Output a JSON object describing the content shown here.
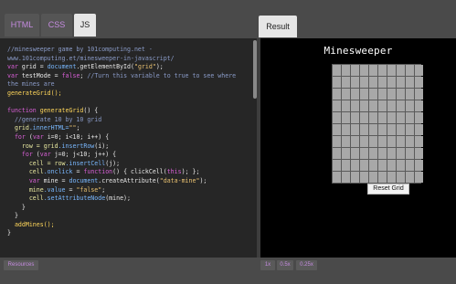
{
  "tabs": {
    "html": "HTML",
    "css": "CSS",
    "js": "JS",
    "result": "Result"
  },
  "result": {
    "title": "Minesweeper",
    "grid_rows": 10,
    "grid_cols": 10,
    "reset_label": "Reset Grid"
  },
  "footer": {
    "resources_label": "Resources",
    "zoom_options": [
      "1x",
      "0.5x",
      "0.25x"
    ]
  },
  "code": {
    "l1": "//minesweeper game by 101computing.net -",
    "l2": "www.101computing.et/minesweeper-in-javascript/",
    "l3a": "var",
    "l3b": " grid = ",
    "l3c": "document",
    "l3d": ".getElementById(",
    "l3e": "\"grid\"",
    "l3f": ");",
    "l4a": "var",
    "l4b": " testMode = ",
    "l4c": "false",
    "l4d": "; ",
    "l4e": "//Turn this variable to true to see where",
    "l5": "the mines are",
    "l6": "generateGrid();",
    "l7a": "function",
    "l7b": " generateGrid",
    "l7c": "() {",
    "l8": "  //generate 10 by 10 grid",
    "l9a": "  grid",
    "l9b": ".innerHTML=",
    "l9c": "\"\"",
    "l9d": ";",
    "l10a": "  for",
    "l10b": " (",
    "l10c": "var",
    "l10d": " i=0; i<10; i++) {",
    "l11a": "    row = grid",
    "l11b": ".insertRow",
    "l11c": "(i);",
    "l12a": "    for",
    "l12b": " (",
    "l12c": "var",
    "l12d": " j=0; j<10; j++) {",
    "l13a": "      cell = row",
    "l13b": ".insertCell",
    "l13c": "(j);",
    "l14a": "      cell",
    "l14b": ".onclick",
    "l14c": " = ",
    "l14d": "function",
    "l14e": "() { clickCell(",
    "l14f": "this",
    "l14g": "); };",
    "l15a": "      var",
    "l15b": " mine = ",
    "l15c": "document",
    "l15d": ".createAttribute(",
    "l15e": "\"data-mine\"",
    "l15f": ");",
    "l16a": "      mine",
    "l16b": ".value",
    "l16c": " = ",
    "l16d": "\"false\"",
    "l16e": ";",
    "l17a": "      cell",
    "l17b": ".setAttributeNode",
    "l17c": "(mine);",
    "l18": "    }",
    "l19": "  }",
    "l20": "  addMines();",
    "l21": "}"
  }
}
